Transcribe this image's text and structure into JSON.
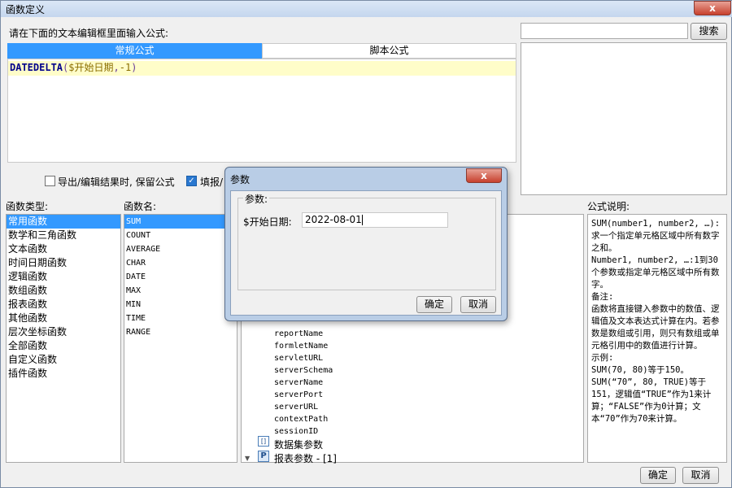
{
  "window": {
    "title": "函数定义",
    "close": "x"
  },
  "editor": {
    "prompt": "请在下面的文本编辑框里面输入公式:",
    "tabs": [
      "常规公式",
      "脚本公式"
    ],
    "formula": {
      "func": "DATEDELTA",
      "open": "(",
      "param": "$开始日期",
      "comma": ",",
      "number": "-1",
      "close": ")"
    }
  },
  "search": {
    "value": "",
    "button": "搜索"
  },
  "options": {
    "keep_formula": {
      "label": "导出/编辑结果时, 保留公式",
      "checked": false
    },
    "fill": {
      "label": "填报/",
      "checked": true
    }
  },
  "categories": {
    "header": "函数类型:",
    "items": [
      "常用函数",
      "数学和三角函数",
      "文本函数",
      "时间日期函数",
      "逻辑函数",
      "数组函数",
      "报表函数",
      "其他函数",
      "层次坐标函数",
      "全部函数",
      "自定义函数",
      "插件函数"
    ],
    "selected": 0
  },
  "functions": {
    "header": "函数名:",
    "items": [
      "SUM",
      "COUNT",
      "AVERAGE",
      "CHAR",
      "DATE",
      "MAX",
      "MIN",
      "TIME",
      "RANGE"
    ],
    "selected": 0
  },
  "tree": {
    "items": [
      "reportName",
      "formletName",
      "servletURL",
      "serverSchema",
      "serverName",
      "serverPort",
      "serverURL",
      "contextPath",
      "sessionID"
    ],
    "dataset_params": "数据集参数",
    "report_params": "报表参数 - [1]"
  },
  "description": {
    "header": "公式说明:",
    "lines": [
      "SUM(number1, number2, …):求一个指定单元格区域中所有数字之和。",
      "Number1, number2, …:1到30个参数或指定单元格区域中所有数字。",
      "备注:",
      "函数将直接键入参数中的数值、逻辑值及文本表达式计算在内。若参数是数组或引用，则只有数组或单元格引用中的数值进行计算。",
      "示例:",
      "SUM(70, 80)等于150。",
      "SUM(“70”, 80, TRUE)等于151，逻辑值“TRUE”作为1来计算；“FALSE”作为0计算；文本“70”作为70来计算。"
    ]
  },
  "buttons": {
    "ok": "确定",
    "cancel": "取消"
  },
  "dialog": {
    "title": "参数",
    "close": "x",
    "group_label": "参数:",
    "param_label": "$开始日期:",
    "param_value": "2022-08-01",
    "ok": "确定",
    "cancel": "取消"
  }
}
